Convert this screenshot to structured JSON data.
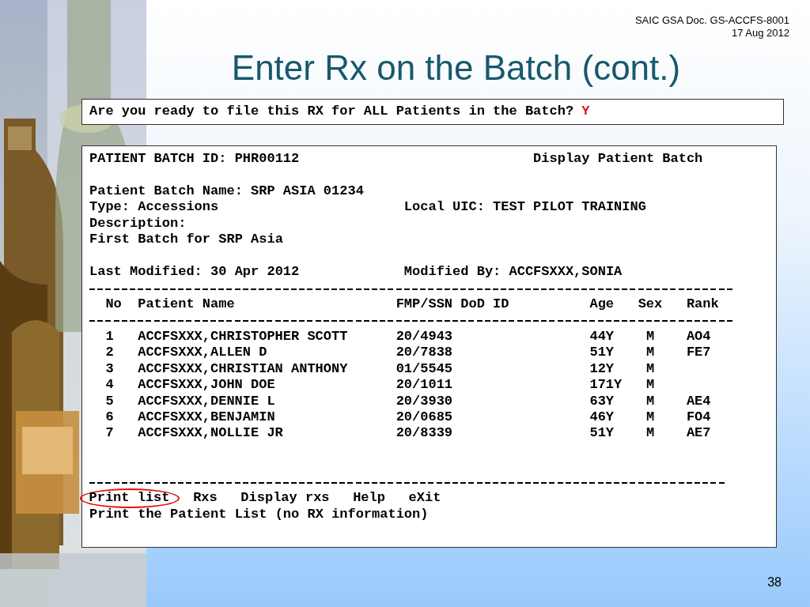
{
  "header": {
    "doc": "SAIC GSA Doc. GS-ACCFS-8001",
    "date": "17 Aug 2012"
  },
  "title": "Enter Rx on the Batch (cont.)",
  "prompt": {
    "question": "Are you ready to file this RX for ALL Patients in the Batch?",
    "answer": "Y"
  },
  "batch": {
    "id_label": "PATIENT BATCH ID: PHR00112",
    "screen_name": "Display Patient Batch",
    "name": "Patient Batch Name: SRP ASIA 01234",
    "type": "Type: Accessions",
    "local_uic": "Local UIC: TEST PILOT TRAINING",
    "description_label": "Description:",
    "description": "First Batch for SRP Asia",
    "last_modified": "Last Modified: 30 Apr 2012",
    "modified_by": "Modified By: ACCFSXXX,SONIA"
  },
  "table": {
    "columns": [
      "No",
      "Patient Name",
      "FMP/SSN",
      "DoD ID",
      "Age",
      "Sex",
      "Rank"
    ],
    "rows": [
      {
        "no": "1",
        "name": "ACCFSXXX,CHRISTOPHER SCOTT",
        "fmp_ssn": "20/4943",
        "age": "44Y",
        "sex": "M",
        "rank": "AO4"
      },
      {
        "no": "2",
        "name": "ACCFSXXX,ALLEN D",
        "fmp_ssn": "20/7838",
        "age": "51Y",
        "sex": "M",
        "rank": "FE7"
      },
      {
        "no": "3",
        "name": "ACCFSXXX,CHRISTIAN ANTHONY",
        "fmp_ssn": "01/5545",
        "age": "12Y",
        "sex": "M"
      },
      {
        "no": "4",
        "name": "ACCFSXXX,JOHN DOE",
        "fmp_ssn": "20/1011",
        "age": "171Y",
        "sex": "M"
      },
      {
        "no": "5",
        "name": "ACCFSXXX,DENNIE L",
        "fmp_ssn": "20/3930",
        "age": "63Y",
        "sex": "M",
        "rank": "AE4"
      },
      {
        "no": "6",
        "name": "ACCFSXXX,BENJAMIN",
        "fmp_ssn": "20/0685",
        "age": "46Y",
        "sex": "M",
        "rank": "FO4"
      },
      {
        "no": "7",
        "name": "ACCFSXXX,NOLLIE JR",
        "fmp_ssn": "20/8339",
        "age": "51Y",
        "sex": "M",
        "rank": "AE7"
      }
    ]
  },
  "menu": [
    {
      "label": "Print list",
      "selected": true
    },
    {
      "label": "Rxs",
      "selected": false
    },
    {
      "label": "Display rxs",
      "selected": false
    },
    {
      "label": "Help",
      "selected": false
    },
    {
      "label": "eXit",
      "selected": false
    }
  ],
  "menu_help": "Print the Patient List (no RX information)",
  "page_number": "38"
}
